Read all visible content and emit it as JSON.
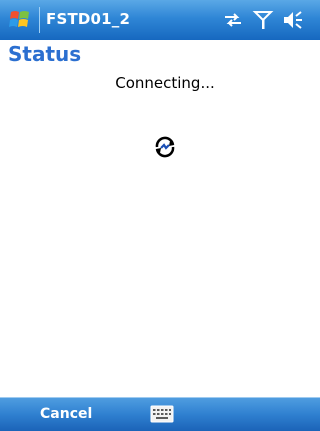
{
  "title_bar": {
    "app_title": "FSTD01_2",
    "icons": [
      "windows-start-icon",
      "connectivity-icon",
      "signal-icon",
      "volume-icon"
    ]
  },
  "page": {
    "heading": "Status",
    "status_message": "Connecting...",
    "busy_icon": "connecting-spinner-icon"
  },
  "menu_bar": {
    "left_softkey": "Cancel",
    "center_icon": "keyboard-icon"
  },
  "colors": {
    "title_bar_blue": "#2f86d6",
    "heading_blue": "#2b6fd0",
    "menu_bar_blue": "#2f80d0",
    "background": "#ffffff"
  }
}
